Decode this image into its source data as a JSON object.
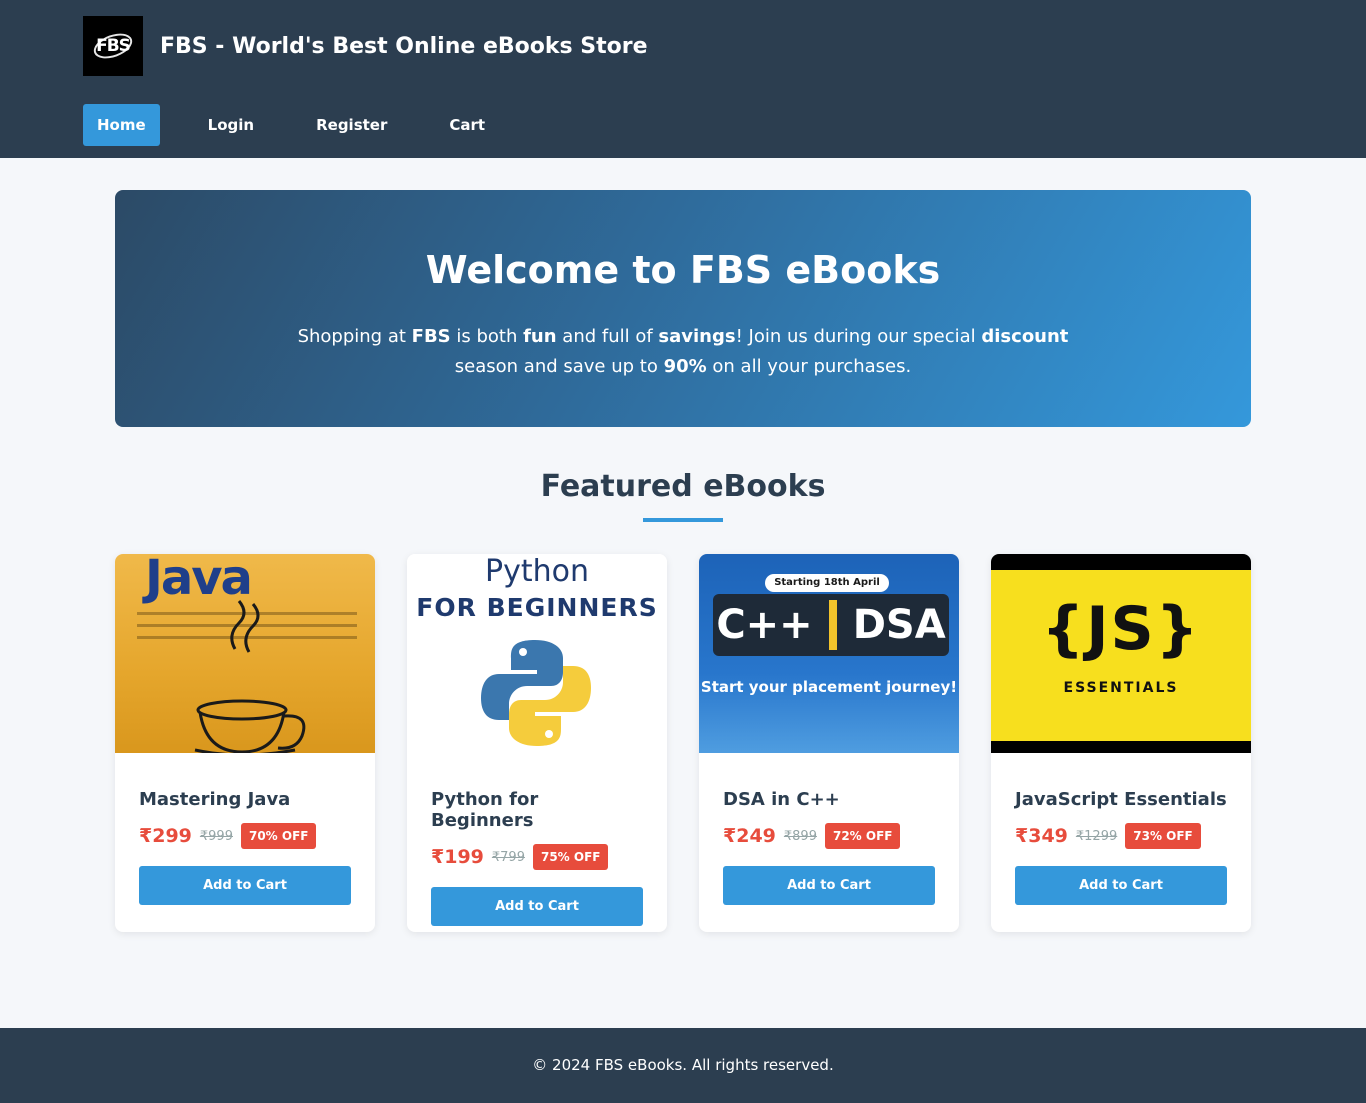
{
  "header": {
    "logo_text": "FBS",
    "title": "FBS - World's Best Online eBooks Store",
    "nav": [
      {
        "label": "Home",
        "active": true
      },
      {
        "label": "Login",
        "active": false
      },
      {
        "label": "Register",
        "active": false
      },
      {
        "label": "Cart",
        "active": false
      }
    ]
  },
  "hero": {
    "heading": "Welcome to FBS eBooks",
    "line_parts": [
      "Shopping at ",
      "FBS",
      " is both ",
      "fun",
      " and full of ",
      "savings",
      "! Join us during our special ",
      "discount",
      " season and save up to ",
      "90%",
      " on all your purchases."
    ]
  },
  "featured": {
    "title": "Featured eBooks",
    "books": [
      {
        "title": "Mastering Java",
        "price": "₹299",
        "old_price": "₹999",
        "discount": "70% OFF",
        "button": "Add to Cart",
        "cover_text": "Java"
      },
      {
        "title": "Python for Beginners",
        "price": "₹199",
        "old_price": "₹799",
        "discount": "75% OFF",
        "button": "Add to Cart",
        "cover_text": "Python",
        "cover_sub": "FOR BEGINNERS"
      },
      {
        "title": "DSA in C++",
        "price": "₹249",
        "old_price": "₹899",
        "discount": "72% OFF",
        "button": "Add to Cart",
        "cover_pill": "Starting 18th April",
        "cover_left": "C++",
        "cover_right": "DSA",
        "cover_tag": "Start your placement journey!"
      },
      {
        "title": "JavaScript Essentials",
        "price": "₹349",
        "old_price": "₹1299",
        "discount": "73% OFF",
        "button": "Add to Cart",
        "cover_text": "{JS}",
        "cover_sub": "ESSENTIALS"
      }
    ]
  },
  "footer": {
    "text": "© 2024 FBS eBooks. All rights reserved."
  },
  "colors": {
    "header_bg": "#2c3e50",
    "accent": "#3498db",
    "price_red": "#e74c3c",
    "page_bg": "#f5f7fa"
  }
}
